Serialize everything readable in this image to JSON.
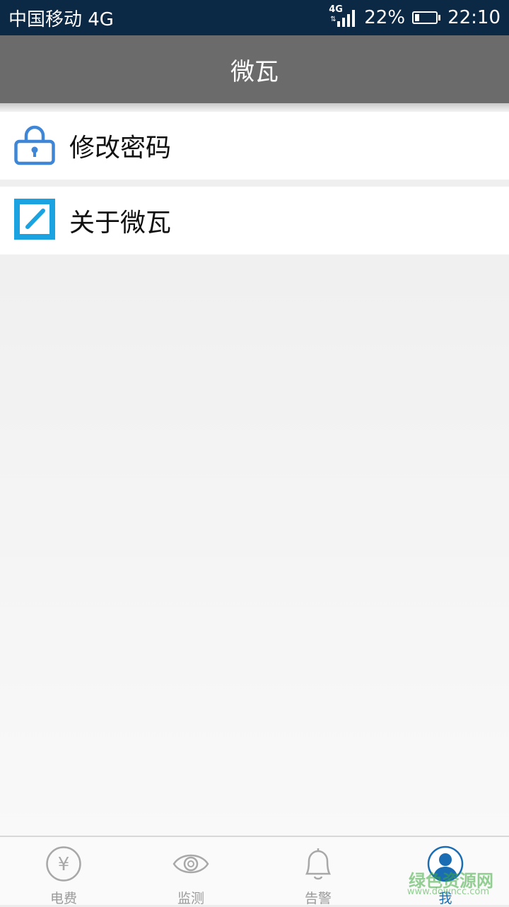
{
  "status_bar": {
    "carrier": "中国移动 4G",
    "network_badge": "4G",
    "battery_percent": "22%",
    "battery_level": 0.22,
    "time": "22:10"
  },
  "header": {
    "title": "微瓦"
  },
  "menu": {
    "items": [
      {
        "label": "修改密码",
        "icon": "lock-icon"
      },
      {
        "label": "关于微瓦",
        "icon": "app-logo-icon"
      }
    ]
  },
  "bottom_nav": {
    "tabs": [
      {
        "label": "电费",
        "icon": "yen-icon",
        "active": false
      },
      {
        "label": "监测",
        "icon": "eye-icon",
        "active": false
      },
      {
        "label": "告警",
        "icon": "bell-icon",
        "active": false
      },
      {
        "label": "我",
        "icon": "user-icon",
        "active": true
      }
    ]
  },
  "watermark": {
    "text": "绿色资源网",
    "sub": "www.downcc.com"
  },
  "colors": {
    "status_bar": "#0b2845",
    "title_bar": "#6b6b6b",
    "accent": "#1b6db3",
    "lock_icon": "#3f86d6",
    "logo": "#1aa3e0"
  }
}
